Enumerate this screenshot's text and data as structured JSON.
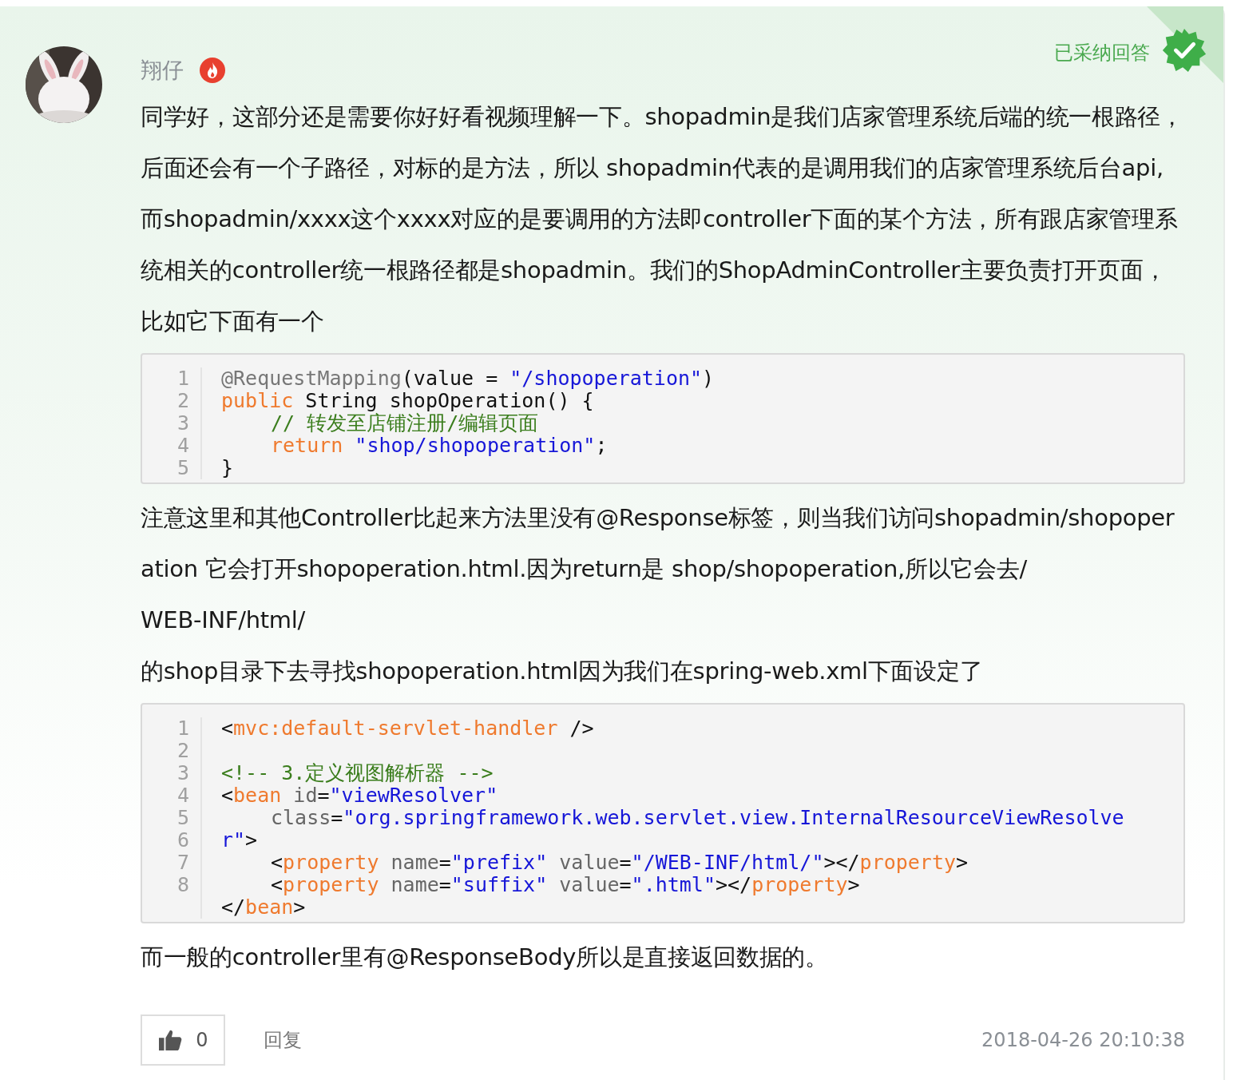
{
  "answer": {
    "author": "翔仔",
    "accepted_label": "已采纳回答",
    "accepted": true,
    "blocks": [
      {
        "kind": "paragraph",
        "text": "同学好，这部分还是需要你好好看视频理解一下。shopadmin是我们店家管理系统后端的统一根路径，后面还会有一个子路径，对标的是方法，所以 shopadmin代表的是调用我们的店家管理系统后台api,而shopadmin/xxxx这个xxxx对应的是要调用的方法即controller下面的某个方法，所有跟店家管理系统相关的controller统一根路径都是shopadmin。我们的ShopAdminController主要负责打开页面，比如它下面有一个"
      },
      {
        "kind": "code",
        "line_numbers": [
          "1",
          "2",
          "3",
          "4",
          "5"
        ],
        "lines": [
          {
            "kind": "code",
            "indented": false,
            "tokens": [
              {
                "kind": "meta",
                "text": "@RequestMapping"
              },
              {
                "kind": "plain",
                "text": "(value = "
              },
              {
                "kind": "string",
                "text": "\"/shopoperation\""
              },
              {
                "kind": "plain",
                "text": ")"
              }
            ]
          },
          {
            "kind": "code",
            "indented": false,
            "tokens": [
              {
                "kind": "keyword",
                "text": "public"
              },
              {
                "kind": "plain",
                "text": " String shopOperation() {"
              }
            ]
          },
          {
            "kind": "code",
            "indented": true,
            "tokens": [
              {
                "kind": "comment",
                "text": "// 转发至店铺注册/编辑页面"
              }
            ]
          },
          {
            "kind": "code",
            "indented": true,
            "tokens": [
              {
                "kind": "keyword",
                "text": "return "
              },
              {
                "kind": "string",
                "text": "\"shop/shopoperation\""
              },
              {
                "kind": "plain",
                "text": ";"
              }
            ]
          },
          {
            "kind": "code",
            "indented": false,
            "tokens": [
              {
                "kind": "plain",
                "text": "}"
              }
            ]
          }
        ]
      },
      {
        "kind": "paragraph",
        "text": "注意这里和其他Controller比起来方法里没有@Response标签，则当我们访问shopadmin/shopoperation 它会打开shopoperation.html.因为return是 shop/shopoperation,所以它会去/"
      },
      {
        "kind": "paragraph",
        "text": "WEB-INF/html/"
      },
      {
        "kind": "paragraph",
        "text": "的shop目录下去寻找shopoperation.html因为我们在spring-web.xml下面设定了"
      },
      {
        "kind": "code",
        "line_numbers": [
          "1",
          "2",
          "3",
          "4",
          "5",
          "6",
          "7",
          "8"
        ],
        "lines": [
          {
            "kind": "code",
            "indented": false,
            "tokens": [
              {
                "kind": "plain",
                "text": "<"
              },
              {
                "kind": "keyword",
                "text": "mvc:default-servlet-handler"
              },
              {
                "kind": "plain",
                "text": " />"
              }
            ]
          },
          {
            "kind": "blank"
          },
          {
            "kind": "code",
            "indented": false,
            "tokens": [
              {
                "kind": "comment",
                "text": "<!-- 3.定义视图解析器 -->"
              }
            ]
          },
          {
            "kind": "code",
            "indented": false,
            "tokens": [
              {
                "kind": "plain",
                "text": "<"
              },
              {
                "kind": "keyword",
                "text": "bean"
              },
              {
                "kind": "attr",
                "text": " id"
              },
              {
                "kind": "plain",
                "text": "="
              },
              {
                "kind": "string",
                "text": "\"viewResolver\""
              }
            ]
          },
          {
            "kind": "code",
            "indented": true,
            "tokens": [
              {
                "kind": "attr",
                "text": "class"
              },
              {
                "kind": "plain",
                "text": "="
              },
              {
                "kind": "string",
                "text": "\"org.springframework.web.servlet.view.InternalResourceViewResolve"
              }
            ]
          },
          {
            "kind": "code",
            "indented": false,
            "tokens": [
              {
                "kind": "string",
                "text": "r\""
              },
              {
                "kind": "plain",
                "text": ">"
              }
            ]
          },
          {
            "kind": "code",
            "indented": true,
            "tokens": [
              {
                "kind": "plain",
                "text": "<"
              },
              {
                "kind": "keyword",
                "text": "property"
              },
              {
                "kind": "attr",
                "text": " name"
              },
              {
                "kind": "plain",
                "text": "="
              },
              {
                "kind": "string",
                "text": "\"prefix\""
              },
              {
                "kind": "attr",
                "text": " value"
              },
              {
                "kind": "plain",
                "text": "="
              },
              {
                "kind": "string",
                "text": "\"/WEB-INF/html/\""
              },
              {
                "kind": "plain",
                "text": "></"
              },
              {
                "kind": "keyword",
                "text": "property"
              },
              {
                "kind": "plain",
                "text": ">"
              }
            ]
          },
          {
            "kind": "code",
            "indented": true,
            "tokens": [
              {
                "kind": "plain",
                "text": "<"
              },
              {
                "kind": "keyword",
                "text": "property"
              },
              {
                "kind": "attr",
                "text": " name"
              },
              {
                "kind": "plain",
                "text": "="
              },
              {
                "kind": "string",
                "text": "\"suffix\""
              },
              {
                "kind": "attr",
                "text": " value"
              },
              {
                "kind": "plain",
                "text": "="
              },
              {
                "kind": "string",
                "text": "\".html\""
              },
              {
                "kind": "plain",
                "text": "></"
              },
              {
                "kind": "keyword",
                "text": "property"
              },
              {
                "kind": "plain",
                "text": ">"
              }
            ]
          },
          {
            "kind": "code",
            "indented": false,
            "tokens": [
              {
                "kind": "plain",
                "text": "</"
              },
              {
                "kind": "keyword",
                "text": "bean"
              },
              {
                "kind": "plain",
                "text": ">"
              }
            ]
          }
        ]
      },
      {
        "kind": "paragraph",
        "text": "而一般的controller里有@ResponseBody所以是直接返回数据的。"
      }
    ],
    "likes": "0",
    "reply_label": "回复",
    "timestamp": "2018-04-26 20:10:38"
  }
}
